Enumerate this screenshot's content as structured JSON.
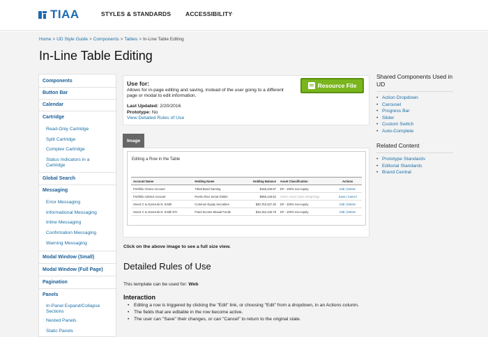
{
  "header": {
    "logo_text": "TIAA",
    "nav": [
      {
        "label": "STYLES & STANDARDS"
      },
      {
        "label": "ACCESSIBILITY"
      }
    ]
  },
  "breadcrumb": [
    "Home",
    "UD Style Guide",
    "Components",
    "Tables",
    "In-Line Table Editing"
  ],
  "page_title": "In-Line Table Editing",
  "sidebar": {
    "items": [
      {
        "label": "Components"
      },
      {
        "label": "Button Bar"
      },
      {
        "label": "Calendar"
      },
      {
        "label": "Cartridge"
      },
      {
        "label": "Read-Only Cartridge"
      },
      {
        "label": "Split Cartridge"
      },
      {
        "label": "Complex Cartridge"
      },
      {
        "label": "Status Indicators in a Cartridge"
      },
      {
        "label": "Global Search"
      },
      {
        "label": "Messaging"
      },
      {
        "label": "Error Messaging"
      },
      {
        "label": "Informational Messaging"
      },
      {
        "label": "Inline Messaging"
      },
      {
        "label": "Confirmation Messaging"
      },
      {
        "label": "Warning Messaging"
      },
      {
        "label": "Modal Window (Small)"
      },
      {
        "label": "Modal Window (Full Page)"
      },
      {
        "label": "Pagination"
      },
      {
        "label": "Panels"
      },
      {
        "label": "In-Panel Expand/Collapse Sections"
      },
      {
        "label": "Nested Panels"
      },
      {
        "label": "Static Panels"
      }
    ]
  },
  "info": {
    "use_for_title": "Use for:",
    "use_for_desc": "Allows for in-page editing and saving, instead of the user going to a different page or modal to edit information.",
    "last_updated_label": "Last Updated:",
    "last_updated_value": "2/20/2016",
    "prototype_label": "Prototype:",
    "prototype_value": "No",
    "rules_link": "View Detailed Rules of Use",
    "resource_button": "Resource File"
  },
  "image_tab": "Image",
  "example": {
    "caption": "Editing a Row in the Table",
    "headers": [
      "Account Name",
      "Holding Name",
      "Holding Balance",
      "Asset Classification",
      "Actions"
    ],
    "rows": [
      [
        "Portfolio Choice Account",
        "Tribal Bond Gaming",
        "$155,448.87",
        "D# - 100% non-equity",
        "Edit | Delete"
      ],
      [
        "Portfolio Advisor Account",
        "Puerto Rico Serial GNMA",
        "$985,148.52",
        "Select Asset Class Weightings",
        "Save | Cancel"
      ],
      [
        "Sneck C & Gorezurk N. Smith",
        "Common Equity Securities",
        "$30,753,327.30",
        "D# - 100% non-equity",
        "Edit | Delete"
      ],
      [
        "Sneck C & Gorezurk N. Smith R/A",
        "Fixed Income Mutual Funds",
        "$18,152,125.78",
        "D# - 100% non-equity",
        "Edit | Delete"
      ]
    ]
  },
  "click_note": "Click on the above image to see a full size view.",
  "detailed_heading": "Detailed Rules of Use",
  "template_line": {
    "prefix": "This template can be used for:",
    "value": "Web"
  },
  "interaction": {
    "heading": "Interaction",
    "bullets": [
      "Editing a row is triggered by clicking the \"Edit\" link, or choosing \"Edit\" from a dropdown, in an Actions column.",
      "The fields that are editable in the row become active.",
      "The user can \"Save\" their changes, or can \"Cancel\" to return to the original state."
    ]
  },
  "right": {
    "shared_title": "Shared Components Used in UD",
    "shared": [
      "Action Dropdown",
      "Carousel",
      "Progress Bar",
      "Slider",
      "Custom Switch",
      "Auto-Complete"
    ],
    "related_title": "Related Content",
    "related": [
      "Prototype Standards",
      "Editorial Standards",
      "Brand Central"
    ]
  }
}
